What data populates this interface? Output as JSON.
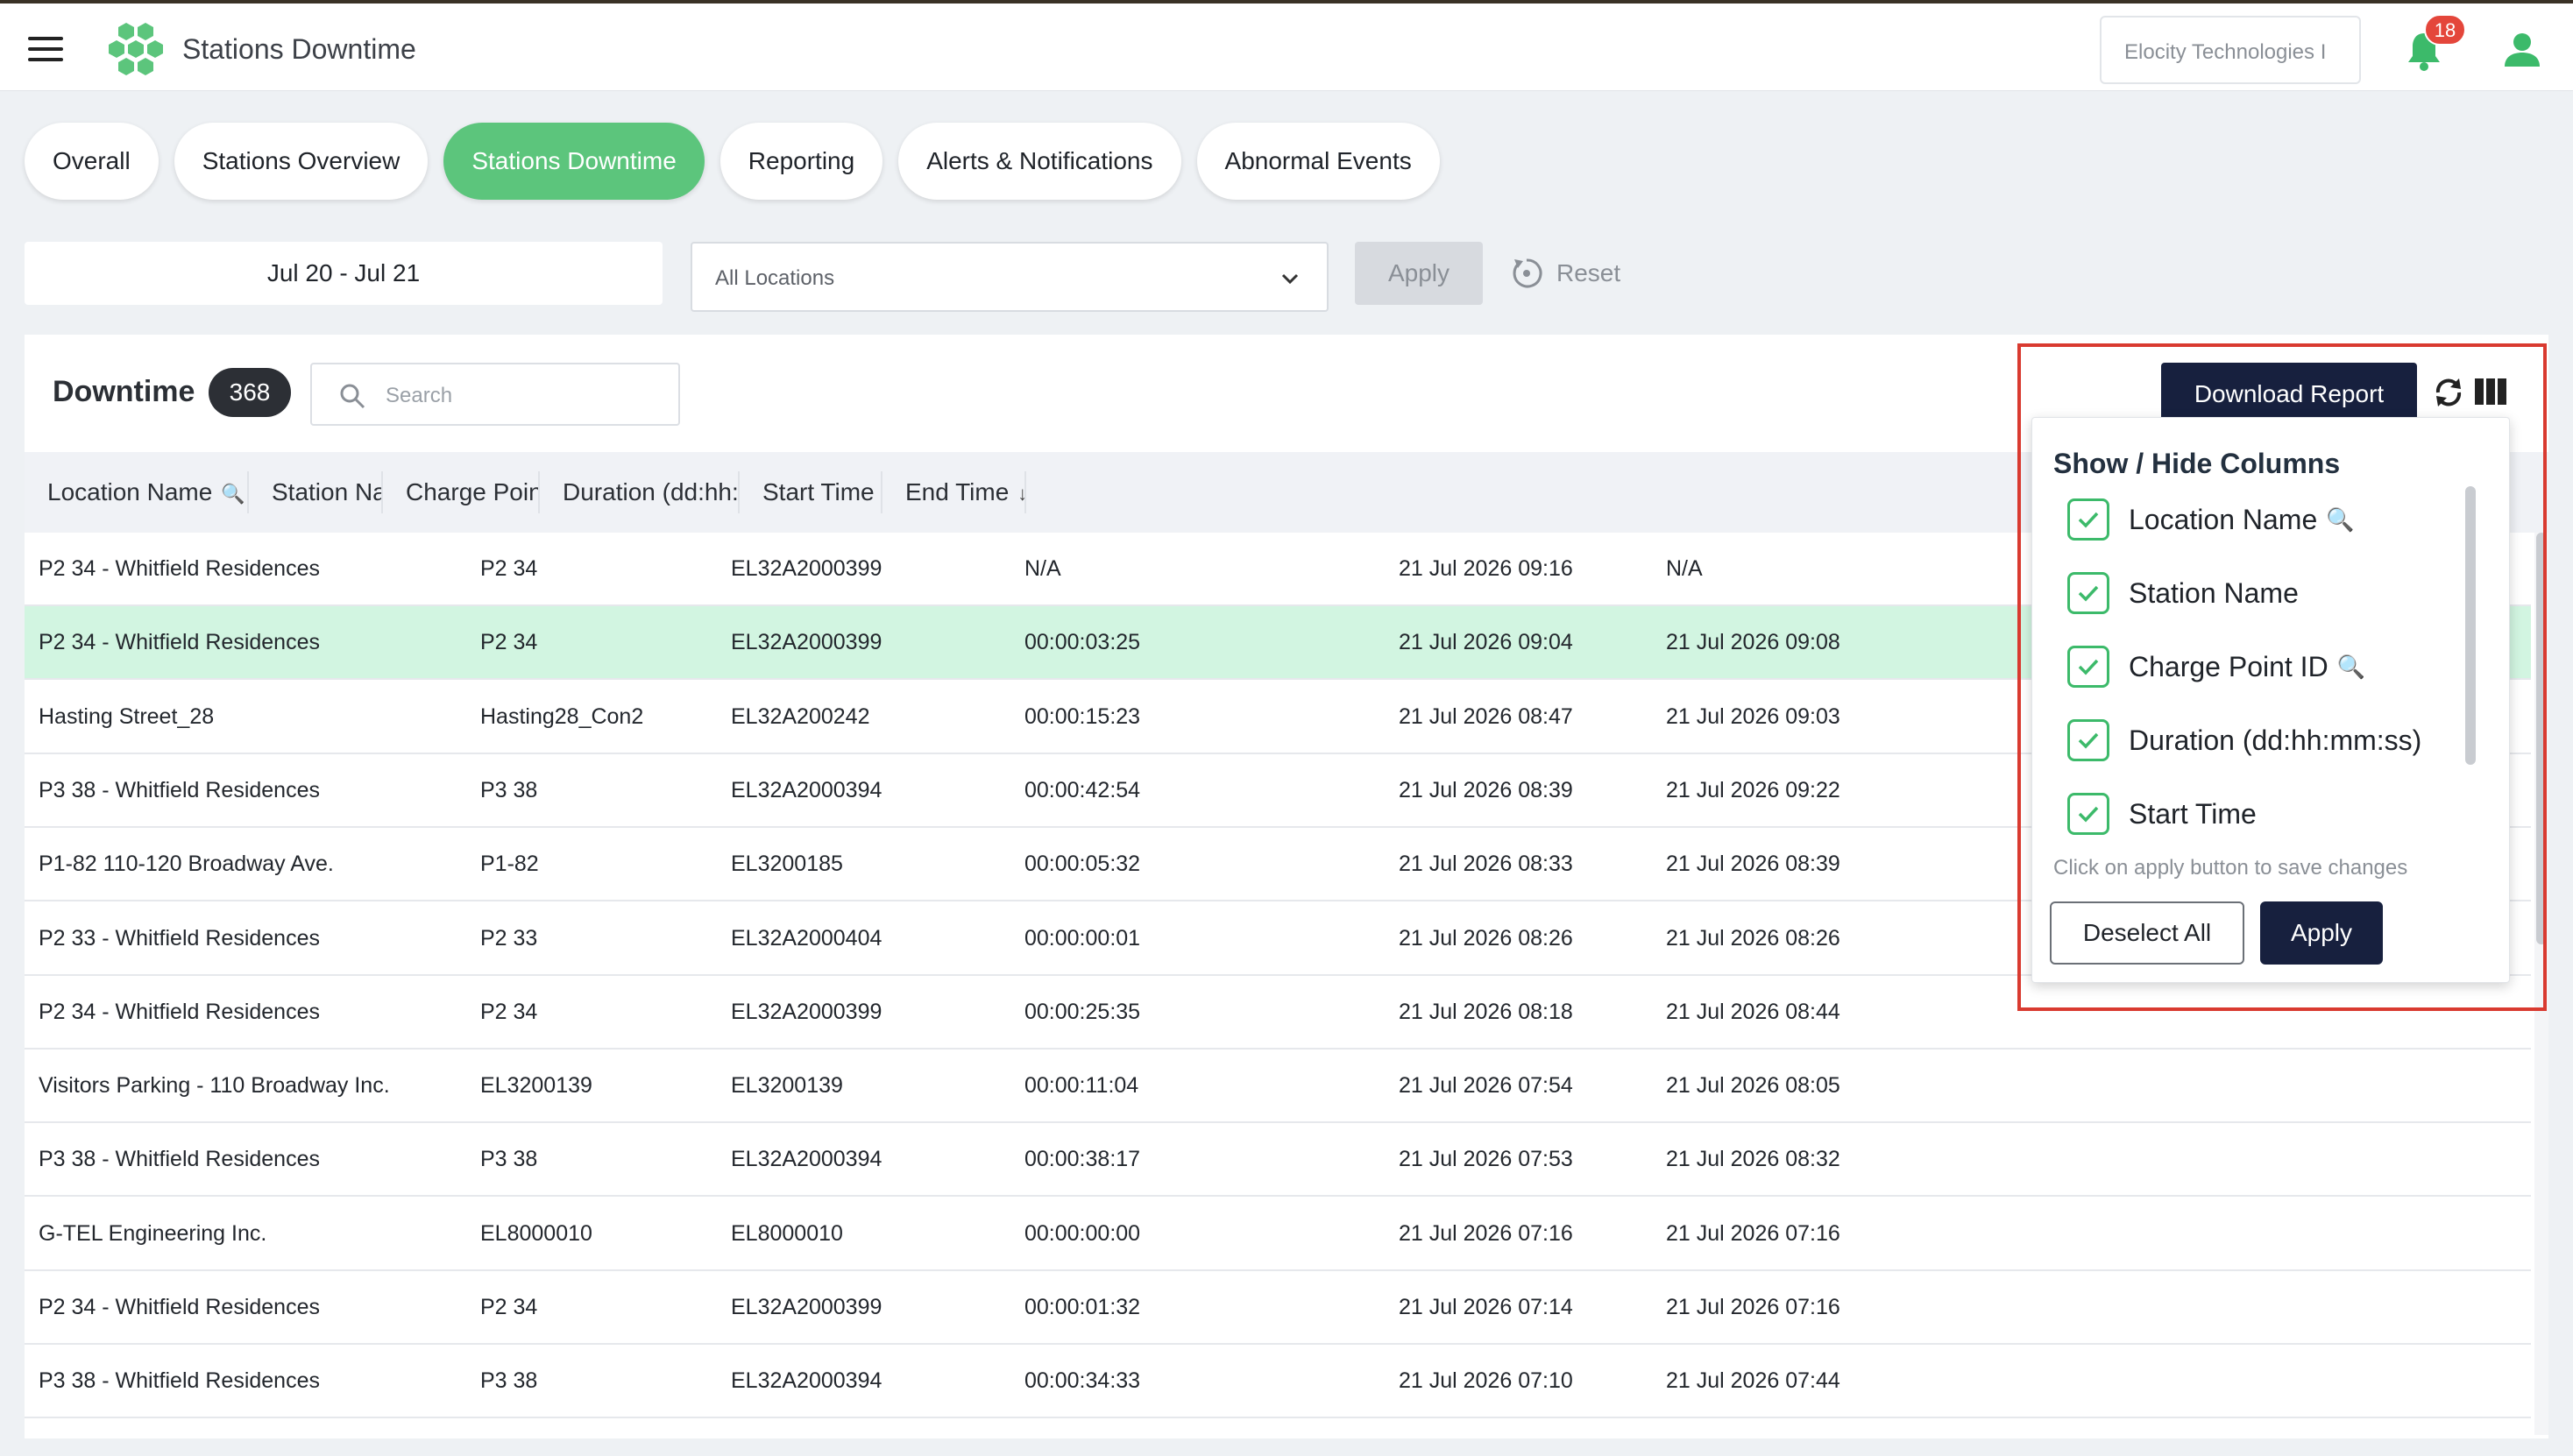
{
  "header": {
    "title": "Stations Downtime",
    "org": "Elocity Technologies I",
    "notifications_count": "18"
  },
  "tabs": [
    {
      "label": "Overall"
    },
    {
      "label": "Stations Overview"
    },
    {
      "label": "Stations Downtime",
      "active": true
    },
    {
      "label": "Reporting"
    },
    {
      "label": "Alerts & Notifications"
    },
    {
      "label": "Abnormal Events"
    }
  ],
  "filters": {
    "date_range": "Jul 20 - Jul 21",
    "location": "All Locations",
    "apply_label": "Apply",
    "reset_label": "Reset"
  },
  "panel": {
    "title": "Downtime",
    "count": "368",
    "search_placeholder": "Search",
    "download_label": "Download Report"
  },
  "table": {
    "columns": [
      "Location Name",
      "Station Name",
      "Charge Point ID",
      "Duration (dd:hh:mm:...",
      "Start Time",
      "End Time"
    ],
    "rows": [
      [
        "P2 34 - Whitfield Residences",
        "P2 34",
        "EL32A2000399",
        "N/A",
        "21 Jul 2026 09:16",
        "N/A"
      ],
      [
        "P2 34 - Whitfield Residences",
        "P2 34",
        "EL32A2000399",
        "00:00:03:25",
        "21 Jul 2026 09:04",
        "21 Jul 2026 09:08"
      ],
      [
        "Hasting Street_28",
        "Hasting28_Con2",
        "EL32A200242",
        "00:00:15:23",
        "21 Jul 2026 08:47",
        "21 Jul 2026 09:03"
      ],
      [
        "P3 38 - Whitfield Residences",
        "P3 38",
        "EL32A2000394",
        "00:00:42:54",
        "21 Jul 2026 08:39",
        "21 Jul 2026 09:22"
      ],
      [
        "P1-82 110-120 Broadway Ave.",
        "P1-82",
        "EL3200185",
        "00:00:05:32",
        "21 Jul 2026 08:33",
        "21 Jul 2026 08:39"
      ],
      [
        "P2 33 - Whitfield Residences",
        "P2 33",
        "EL32A2000404",
        "00:00:00:01",
        "21 Jul 2026 08:26",
        "21 Jul 2026 08:26"
      ],
      [
        "P2 34 - Whitfield Residences",
        "P2 34",
        "EL32A2000399",
        "00:00:25:35",
        "21 Jul 2026 08:18",
        "21 Jul 2026 08:44"
      ],
      [
        "Visitors Parking - 110 Broadway Inc.",
        "EL3200139",
        "EL3200139",
        "00:00:11:04",
        "21 Jul 2026 07:54",
        "21 Jul 2026 08:05"
      ],
      [
        "P3 38 - Whitfield Residences",
        "P3 38",
        "EL32A2000394",
        "00:00:38:17",
        "21 Jul 2026 07:53",
        "21 Jul 2026 08:32"
      ],
      [
        "G-TEL Engineering Inc.",
        "EL8000010",
        "EL8000010",
        "00:00:00:00",
        "21 Jul 2026 07:16",
        "21 Jul 2026 07:16"
      ],
      [
        "P2 34 - Whitfield Residences",
        "P2 34",
        "EL32A2000399",
        "00:00:01:32",
        "21 Jul 2026 07:14",
        "21 Jul 2026 07:16"
      ],
      [
        "P3 38 - Whitfield Residences",
        "P3 38",
        "EL32A2000394",
        "00:00:34:33",
        "21 Jul 2026 07:10",
        "21 Jul 2026 07:44"
      ]
    ]
  },
  "column_picker": {
    "title": "Show / Hide Columns",
    "options": [
      {
        "label": "Location Name",
        "checked": true,
        "searchable": true
      },
      {
        "label": "Station Name",
        "checked": true
      },
      {
        "label": "Charge Point ID",
        "checked": true,
        "searchable": true
      },
      {
        "label": "Duration (dd:hh:mm:ss)",
        "checked": true
      },
      {
        "label": "Start Time",
        "checked": true
      }
    ],
    "hint": "Click on apply button to save changes",
    "deselect_label": "Deselect All",
    "apply_label": "Apply"
  },
  "colors": {
    "accent_green": "#5cc57c",
    "row_highlight": "#d2f5e1",
    "navy": "#17203e",
    "alert_red": "#e4463b"
  }
}
